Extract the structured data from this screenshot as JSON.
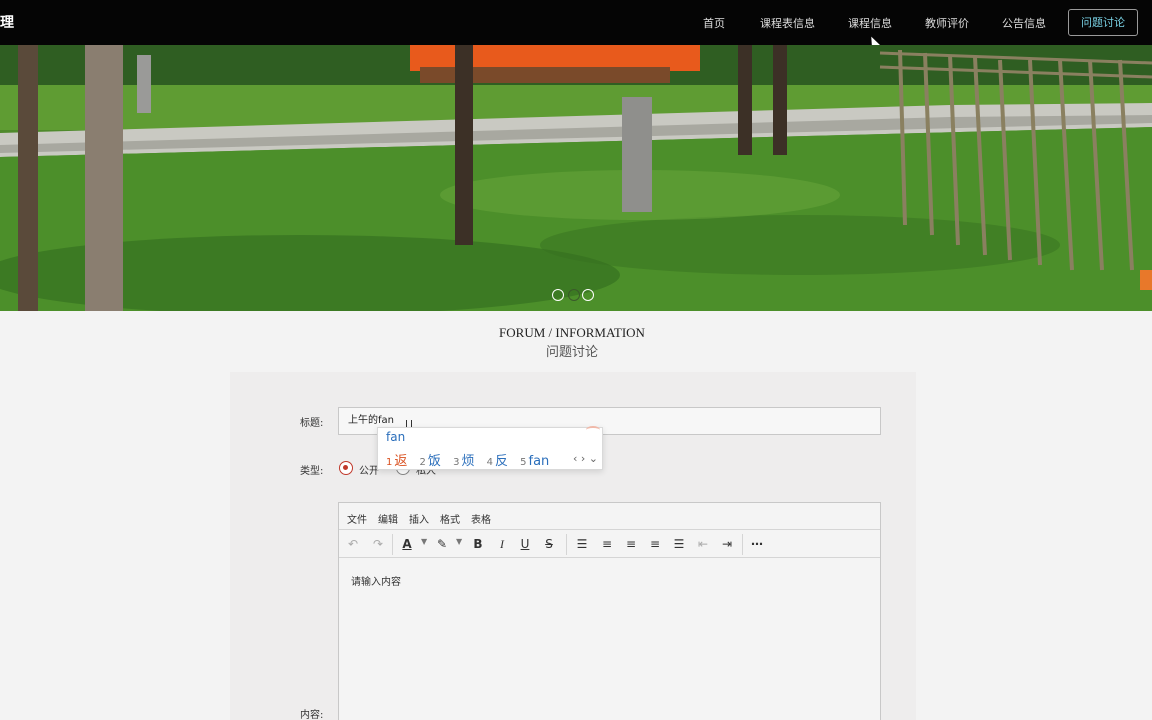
{
  "nav": {
    "brand": "理",
    "items": [
      "首页",
      "课程表信息",
      "课程信息",
      "教师评价",
      "公告信息"
    ],
    "active": "问题讨论"
  },
  "banner": {
    "slide_count": 3,
    "active_slide": 2
  },
  "heading": {
    "en": "FORUM / INFORMATION",
    "cn": "问题讨论"
  },
  "form": {
    "title_label": "标题:",
    "title_value": "上午的fan",
    "type_label": "类型:",
    "type_options": [
      "公开",
      "私人"
    ],
    "type_selected": "公开",
    "content_label": "内容:"
  },
  "ime": {
    "pinyin": "fan",
    "candidates": [
      {
        "n": "1",
        "text": "返"
      },
      {
        "n": "2",
        "text": "饭"
      },
      {
        "n": "3",
        "text": "烦"
      },
      {
        "n": "4",
        "text": "反"
      },
      {
        "n": "5",
        "text": "fan"
      }
    ],
    "nav": "‹ › ⌄"
  },
  "editor": {
    "menus": [
      "文件",
      "编辑",
      "插入",
      "格式",
      "表格"
    ],
    "placeholder": "请输入内容",
    "colors": {
      "accent": "#c0392b",
      "nav_bg": "#050505",
      "cta_text": "#7ad3e6"
    }
  }
}
